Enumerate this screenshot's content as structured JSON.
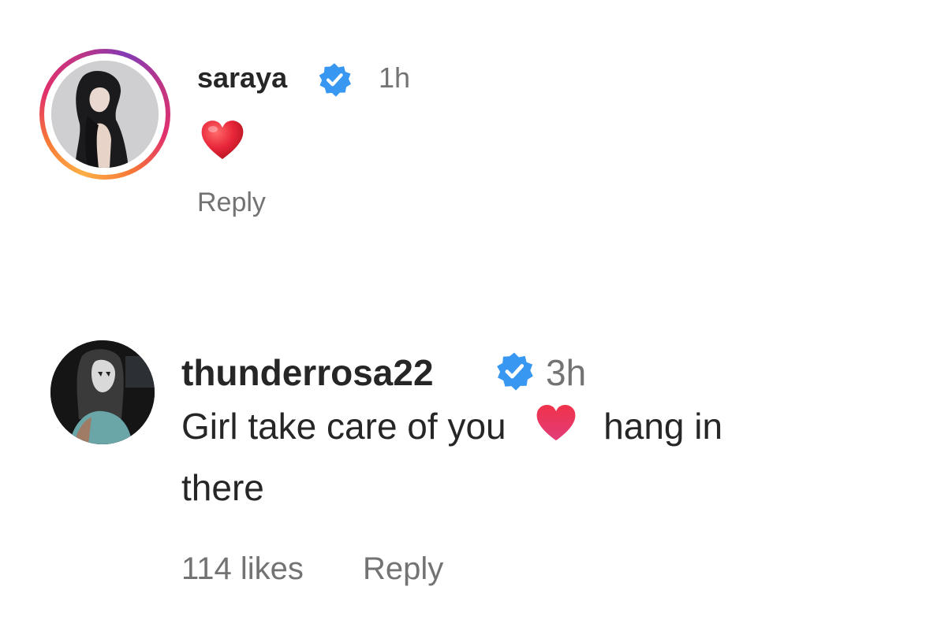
{
  "comments": [
    {
      "username": "saraya",
      "verified": true,
      "time": "1h",
      "text_emoji": "heart-red",
      "reply_label": "Reply",
      "avatar_story_ring": true
    },
    {
      "username": "thunderrosa22",
      "verified": true,
      "time": "3h",
      "text_before": "Girl take care of you",
      "text_emoji": "heart-pink",
      "text_after": "hang in",
      "text_line2": "there",
      "likes_label": "114 likes",
      "reply_label": "Reply"
    }
  ],
  "colors": {
    "verified_blue": "#3897f0",
    "meta_gray": "#737373",
    "heart_red": "#e0283a",
    "heart_pink": "#e8335b"
  }
}
